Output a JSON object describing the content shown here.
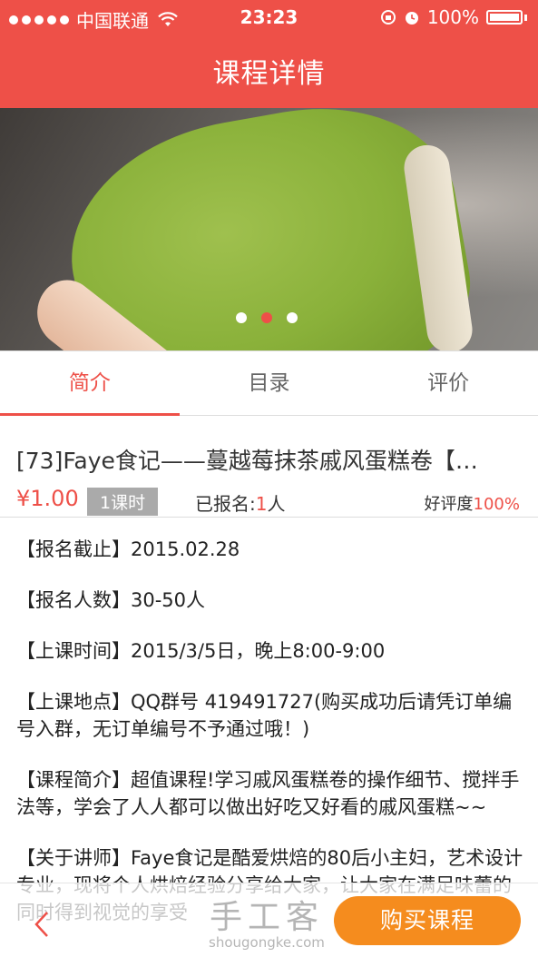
{
  "status_bar": {
    "carrier": "中国联通",
    "time": "23:23",
    "battery": "100%"
  },
  "header": {
    "title": "课程详情"
  },
  "carousel": {
    "page_count": 3,
    "active_index": 1
  },
  "tabs": [
    {
      "label": "简介",
      "active": true
    },
    {
      "label": "目录",
      "active": false
    },
    {
      "label": "评价",
      "active": false
    }
  ],
  "course": {
    "title": "[73]Faye食记——蔓越莓抹茶戚风蛋糕卷【…",
    "price": "¥1.00",
    "lessons": "1课时",
    "enrolled_label": "已报名:",
    "enrolled_count": "1",
    "enrolled_unit": "人",
    "rating_label": "好评度",
    "rating_value": "100%"
  },
  "details": [
    "【报名截止】2015.02.28",
    "【报名人数】30-50人",
    "【上课时间】2015/3/5日，晚上8:00-9:00",
    "【上课地点】QQ群号  419491727(购买成功后请凭订单编号入群，无订单编号不予通过哦！)",
    "【课程简介】超值课程!学习戚风蛋糕卷的操作细节、搅拌手法等，学会了人人都可以做出好吃又好看的戚风蛋糕~~",
    "【关于讲师】Faye食记是酷爱烘焙的80后小主妇，艺术设计专业，现将个人烘焙经验分享给大家，让大家在满足味蕾的同时得到视觉的享受"
  ],
  "bottom_bar": {
    "watermark_main": "手工客",
    "watermark_url": "shougongke.com",
    "buy_label": "购买课程"
  },
  "colors": {
    "accent": "#ee5048",
    "buy": "#f58c1e"
  }
}
